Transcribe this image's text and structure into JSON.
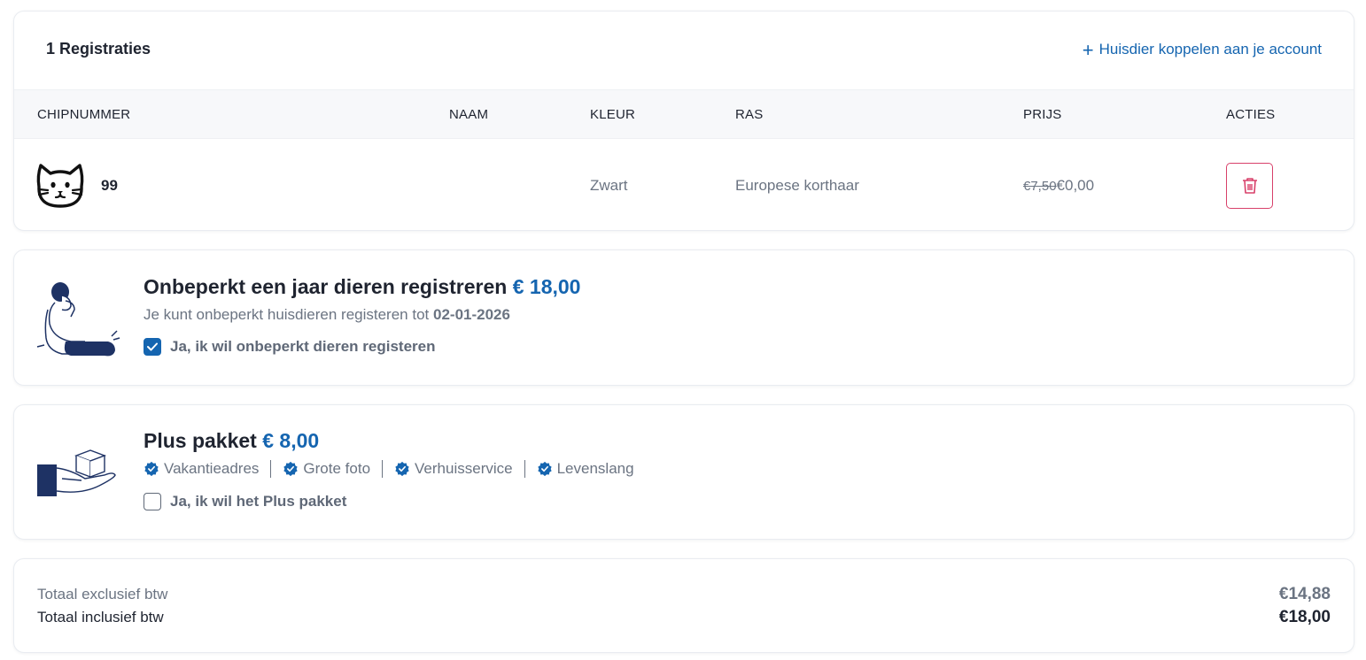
{
  "registrations": {
    "title": "1 Registraties",
    "add_link": "Huisdier koppelen aan je account",
    "columns": [
      "CHIPNUMMER",
      "NAAM",
      "KLEUR",
      "RAS",
      "PRIJS",
      "ACTIES"
    ],
    "rows": [
      {
        "animal_icon": "cat-icon",
        "chipnummer": "99",
        "naam": "",
        "kleur": "Zwart",
        "ras": "Europese korthaar",
        "old_price": "€7,50",
        "price": "€0,00"
      }
    ]
  },
  "unlimited": {
    "title": "Onbeperkt een jaar dieren registreren",
    "price": "€ 18,00",
    "subtitle_prefix": "Je kunt onbeperkt huisdieren registeren tot",
    "until_date": "02-01-2026",
    "checkbox_label": "Ja, ik wil onbeperkt dieren registeren",
    "checked": true
  },
  "plus": {
    "title": "Plus pakket",
    "price": "€ 8,00",
    "features": [
      "Vakantieadres",
      "Grote foto",
      "Verhuisservice",
      "Levenslang"
    ],
    "checkbox_label": "Ja, ik wil het Plus pakket",
    "checked": false
  },
  "totals": {
    "excl_label": "Totaal exclusief btw",
    "excl_value": "€14,88",
    "incl_label": "Totaal inclusief btw",
    "incl_value": "€18,00"
  },
  "colors": {
    "accent": "#1565b0",
    "navy": "#1e3264",
    "danger": "#d8406a",
    "muted": "#6b7482"
  }
}
